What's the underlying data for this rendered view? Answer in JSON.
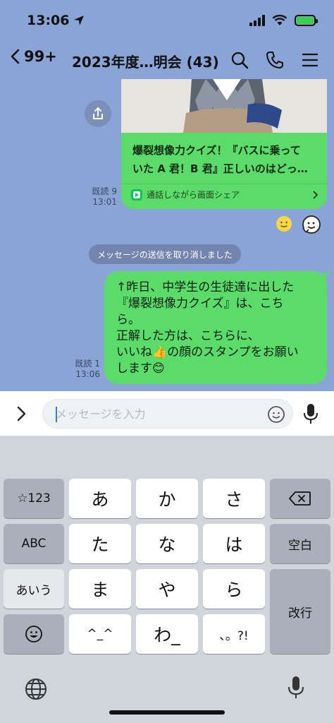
{
  "status_bar": {
    "time": "13:06"
  },
  "header": {
    "back_count": "99+",
    "title": "2023年度…明会 (43)"
  },
  "chat": {
    "link_card": {
      "title": "爆裂想像力クイズ！『バスに乗っていた A 君！B 君』正しいのはどっ…",
      "title_line1": "爆裂想像力クイズ！『バスに乗って",
      "title_line2": "いた A 君！B 君』正しいのはどっ…",
      "action": "通話しながら画面シェア"
    },
    "card_read_status": "既読 9",
    "card_time": "13:01",
    "system_notice": "メッセージの送信を取り消しました",
    "message": {
      "line1": "↑昨日、中学生の生徒達に出した",
      "line2": "『爆裂想像力クイズ』は、こち",
      "line3": "ら。",
      "line4": "正解した方は、こちらに、",
      "line5": "いいね👍の顔のスタンプをお願い",
      "line6": "します😊",
      "read_status": "既読 1",
      "time": "13:06"
    }
  },
  "input": {
    "placeholder": "メッセージを入力"
  },
  "keyboard": {
    "row1": [
      "☆123",
      "あ",
      "か",
      "さ"
    ],
    "row2": [
      "ABC",
      "た",
      "な",
      "は",
      "空白"
    ],
    "row3": [
      "あいう",
      "ま",
      "や",
      "ら"
    ],
    "row4": [
      "^_^",
      "わ_",
      "、。?!"
    ],
    "enter": "改行"
  },
  "colors": {
    "chat_background": "#8aa4d6",
    "bubble": "#5bdc6a",
    "keyboard": "#d0d4db"
  }
}
